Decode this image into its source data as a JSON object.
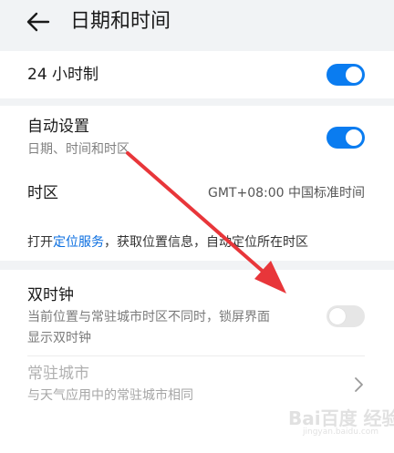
{
  "header": {
    "title": "日期和时间",
    "back_icon": "arrow-left-icon"
  },
  "settings": {
    "hour24": {
      "label": "24 小时制",
      "enabled": true
    },
    "auto": {
      "label": "自动设置",
      "sublabel": "日期、时间和时区",
      "enabled": true
    },
    "timezone": {
      "label": "时区",
      "value": "GMT+08:00 中国标准时间"
    },
    "location_hint": {
      "prefix": "打开",
      "link": "定位服务",
      "suffix": "，获取位置信息，自动定位所在时区"
    },
    "dual_clock": {
      "label": "双时钟",
      "sublabel_line1": "当前位置与常驻城市时区不同时，锁屏界面",
      "sublabel_line2": "显示双时钟",
      "enabled": false
    },
    "home_city": {
      "label": "常驻城市",
      "sublabel": "与天气应用中的常驻城市相同",
      "chevron_icon": "chevron-right-icon"
    }
  },
  "colors": {
    "accent": "#0a7cf0",
    "link": "#0a6ee0",
    "background": "#f1f3f5",
    "annotation_arrow": "#e8363a"
  },
  "watermark": {
    "text": "Bai百度 经验",
    "sub": "jingyan.baidu.com"
  }
}
